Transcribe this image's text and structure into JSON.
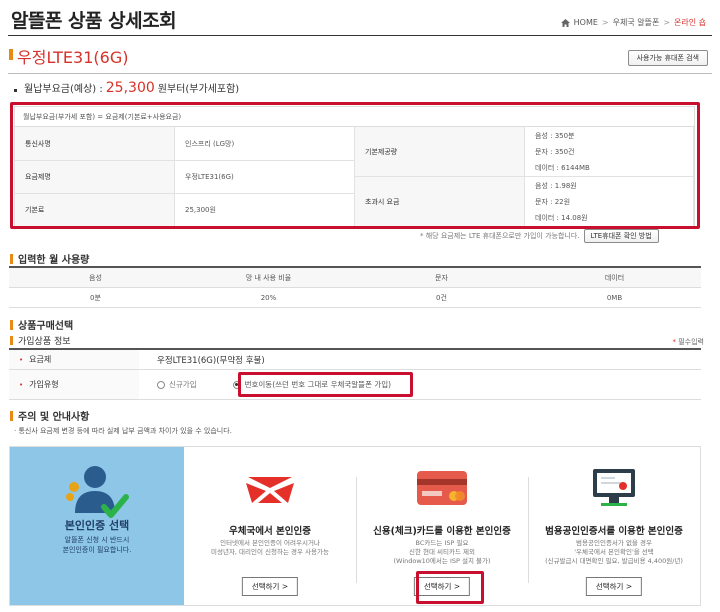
{
  "header": {
    "title": "알뜰폰 상품 상세조회",
    "breadcrumb": [
      "HOME",
      "우체국 알뜰폰",
      "온라인 숍"
    ]
  },
  "product": {
    "name": "우정LTE31(6G)",
    "search_button": "사용가능 휴대폰 검색"
  },
  "monthly_fee": {
    "label": "월납부요금(예상) :",
    "value": "25,300",
    "suffix": "원부터(부가세포함)"
  },
  "detail_table": {
    "formula": "월납부요금(부가세 포함) = 요금제(기본료+사용요금)",
    "carrier_label": "통신사명",
    "carrier_value": "인스프리 (LG망)",
    "plan_label": "요금제명",
    "plan_value": "우정LTE31(6G)",
    "basic_fee_label": "기본료",
    "basic_fee_value": "25,300원",
    "provided_label": "기본제공량",
    "provided": [
      "음성 : 350분",
      "문자 : 350건",
      "데이터 : 6144MB"
    ],
    "overage_label": "초과시 요금",
    "overage": [
      "음성 : 1.98원",
      "문자 : 22원",
      "데이터 : 14.08원"
    ]
  },
  "note": {
    "text": "* 해당 요금제는 LTE 휴대폰으로만 가입이 가능합니다.",
    "button": "LTE휴대폰 확인 방법"
  },
  "usage": {
    "title": "입력한 월 사용량",
    "headers": [
      "음성",
      "망 내 사용 비율",
      "문자",
      "데이터"
    ],
    "values": [
      "0분",
      "20%",
      "0건",
      "0MB"
    ]
  },
  "purchase": {
    "title": "상품구매선택",
    "subscription_title": "가입상품 정보",
    "required_label": "필수입력",
    "required_star": "*",
    "plan_row_label": "요금제",
    "plan_row_value": "우정LTE31(6G)(무약정 후불)",
    "type_row_label": "가입유형",
    "option_new": "신규가입",
    "option_port": "번호이동(쓰던 번호 그대로 우체국알뜰폰 가입)"
  },
  "caution": {
    "title": "주의 및 안내사항",
    "text": "· 통신사 요금제 변경 등에 따라 실제 납부 금액과 차이가 있을 수 있습니다."
  },
  "auth": {
    "intro_title": "본인인증 선택",
    "intro_desc": [
      "알뜰폰 신청 시 반드시",
      "본인인증이 필요합니다."
    ],
    "methods": [
      {
        "title": "우체국에서 본인인증",
        "desc": [
          "인터넷에서 본인인증이 어려우시거나",
          "미성년자, 대리인이 신청하는 경우 사용가능"
        ],
        "button": "선택하기 >"
      },
      {
        "title": "신용(체크)카드를 이용한 본인인증",
        "desc": [
          "BC카드는 ISP 필요",
          "신한 현대 씨티카드 제외",
          "(Window10에서는 ISP 설치 불가)"
        ],
        "button": "선택하기 >"
      },
      {
        "title": "범용공인인증서를 이용한 본인인증",
        "desc": [
          "범용공인인증서가 없을 경우",
          "'우체국에서 본인확인'을 선택",
          "(신규발급시 대면확인 필요, 발급비용 4,400원/년)"
        ],
        "button": "선택하기 >"
      }
    ]
  },
  "colors": {
    "accent_red": "#d6322b",
    "highlight_box": "#c8102e",
    "section_orange": "#e88b16",
    "auth_panel_blue": "#8ec6e8"
  }
}
